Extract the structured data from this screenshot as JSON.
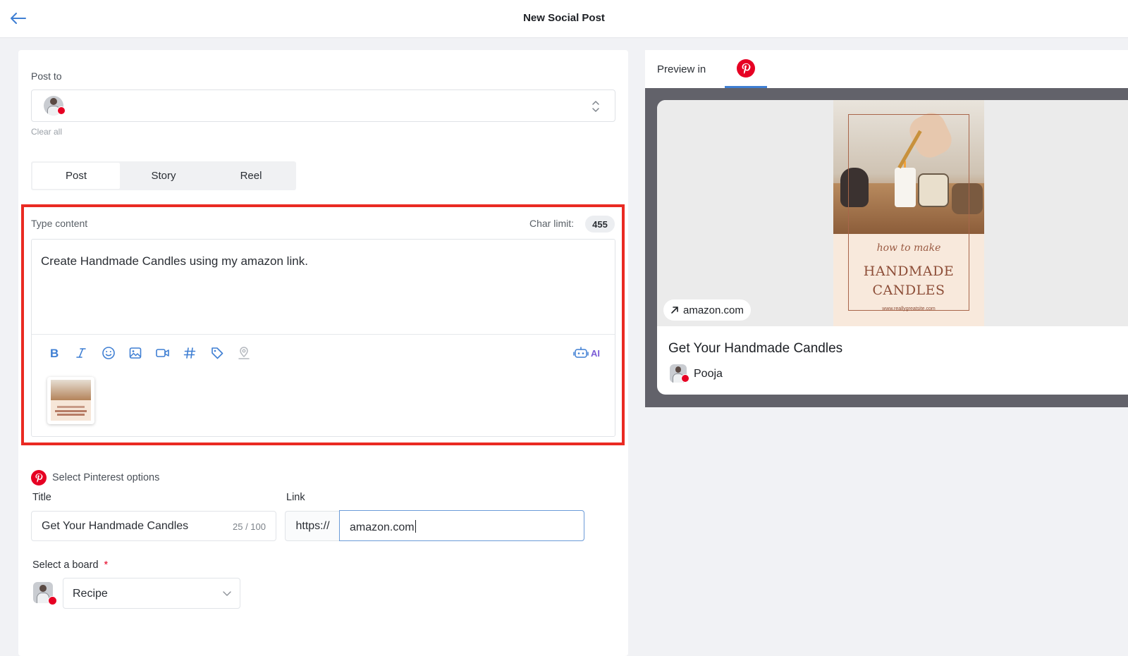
{
  "header": {
    "title": "New Social Post"
  },
  "post_to": {
    "label": "Post to",
    "clear_label": "Clear all"
  },
  "tabs": [
    {
      "label": "Post"
    },
    {
      "label": "Story"
    },
    {
      "label": "Reel"
    }
  ],
  "content": {
    "label": "Type content",
    "char_limit_label": "Char limit:",
    "char_limit_value": "455",
    "text": "Create Handmade Candles using my amazon link.",
    "ai_label": "AI"
  },
  "pinterest": {
    "options_label": "Select Pinterest options",
    "title_label": "Title",
    "title_value": "Get Your Handmade Candles",
    "title_count": "25 / 100",
    "link_label": "Link",
    "link_prefix": "https://",
    "link_value": "amazon.com",
    "board_label": "Select a board",
    "board_required": "*",
    "board_value": "Recipe"
  },
  "preview": {
    "label": "Preview in",
    "domain": "amazon.com",
    "title": "Get Your Handmade Candles",
    "author": "Pooja",
    "image_script": "how to make",
    "image_title_line1": "HANDMADE",
    "image_title_line2": "CANDLES",
    "image_url": "www.reallygreatsite.com"
  },
  "colors": {
    "accent": "#3f7fd3",
    "pinterest": "#e60023",
    "highlight": "#ea2a22",
    "ai": "#7b5cd6"
  }
}
